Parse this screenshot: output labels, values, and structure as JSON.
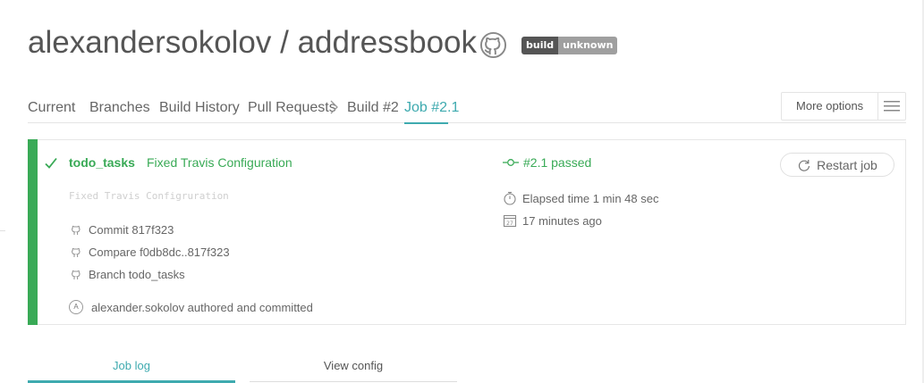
{
  "header": {
    "owner": "alexandersokolov",
    "separator": " / ",
    "repo": "addressbook",
    "badge_label": "build",
    "badge_status": "unknown"
  },
  "tabs": {
    "current": "Current",
    "branches": "Branches",
    "build_history": "Build History",
    "pull_requests": "Pull Requests",
    "build": "Build #2",
    "job": "Job #2.1",
    "more_options": "More options"
  },
  "job": {
    "branch": "todo_tasks",
    "message": "Fixed Travis Configuration",
    "message_body": "Fixed Travis Configruration",
    "commit": "Commit 817f323",
    "compare": "Compare f0db8dc..817f323",
    "branch_link": "Branch todo_tasks",
    "author_initial": "A",
    "author": "alexander.sokolov authored and committed",
    "status": "#2.1 passed",
    "elapsed": "Elapsed time 1 min 48 sec",
    "finished": "17 minutes ago",
    "calendar_day": "27",
    "restart": "Restart job"
  },
  "log_tabs": {
    "job_log": "Job log",
    "view_config": "View config"
  },
  "colors": {
    "passed": "#39aa56",
    "accent": "#3eaaaf",
    "text": "#666666"
  },
  "icons": {
    "repo": "github-icon",
    "check": "check-icon",
    "commit": "github-small-icon",
    "status": "commit-node-icon",
    "elapsed": "stopwatch-icon",
    "finished": "calendar-icon",
    "restart": "restart-icon",
    "menu": "hamburger-icon"
  }
}
